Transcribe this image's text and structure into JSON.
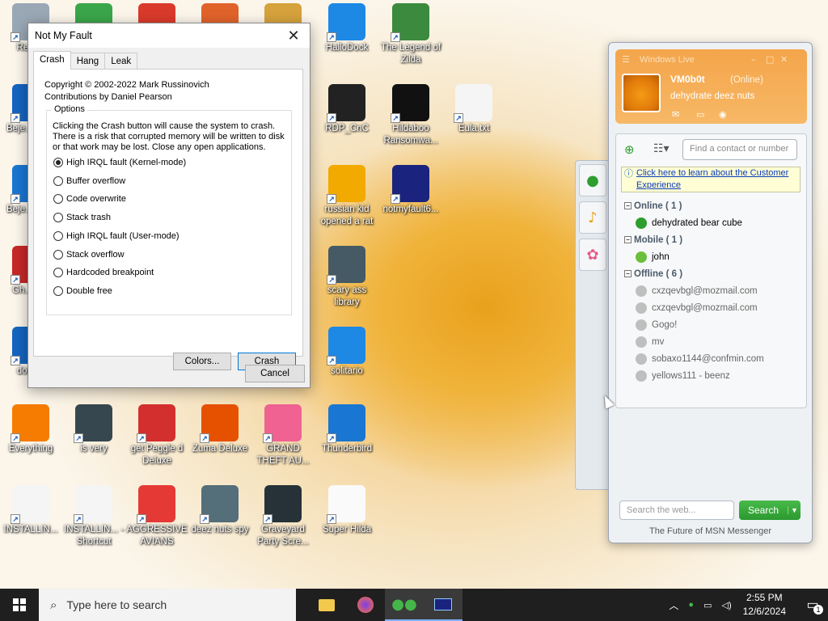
{
  "desktop": {
    "icons": [
      {
        "label": "Recy...",
        "color": "#9aa7b5"
      },
      {
        "label": "",
        "color": "#3aa64a"
      },
      {
        "label": "",
        "color": "#d93a2b"
      },
      {
        "label": "",
        "color": "#e0632a"
      },
      {
        "label": "",
        "color": "#d6a23c"
      },
      {
        "label": "HalloDock",
        "color": "#1e88e5"
      },
      {
        "label": "The Legend of Zilda",
        "color": "#3b8a3e"
      },
      {
        "label": "Beje... De...",
        "color": "#1565c0"
      },
      {
        "label": "RDP_CnC",
        "color": "#222222"
      },
      {
        "label": "Hildaboo Ransomwa...",
        "color": "#111111"
      },
      {
        "label": "Eula.txt",
        "color": "#f5f5f5"
      },
      {
        "label": "Beje... De...",
        "color": "#1976d2"
      },
      {
        "label": "russian kid opened a rat",
        "color": "#f2a900"
      },
      {
        "label": "notmyfault6...",
        "color": "#1a237e"
      },
      {
        "label": "Gh... D...",
        "color": "#c62828"
      },
      {
        "label": "scary ass library",
        "color": "#455a64"
      },
      {
        "label": "does...",
        "color": "#1565c0"
      },
      {
        "label": "solitario",
        "color": "#1e88e5"
      },
      {
        "label": "Everything",
        "color": "#f57c00"
      },
      {
        "label": "is very",
        "color": "#37474f"
      },
      {
        "label": "get Peggle d Deluxe",
        "color": "#d32f2f"
      },
      {
        "label": "Zuma Deluxe",
        "color": "#e65100"
      },
      {
        "label": "GRAND THEFT AU...",
        "color": "#f06292"
      },
      {
        "label": "Thunderbird",
        "color": "#1976d2"
      },
      {
        "label": "INSTALLIN...",
        "color": "#f5f5f5"
      },
      {
        "label": "INSTALLIN... - Shortcut",
        "color": "#f5f5f5"
      },
      {
        "label": "AGGRESSIVE AVIANS",
        "color": "#e53935"
      },
      {
        "label": "deez nuts spy",
        "color": "#546e7a"
      },
      {
        "label": "Graveyard Party Scre...",
        "color": "#263238"
      },
      {
        "label": "Super Hilda",
        "color": "#fafafa"
      }
    ]
  },
  "notmyfault": {
    "title": "Not My Fault",
    "tabs": [
      "Crash",
      "Hang",
      "Leak"
    ],
    "copyright": "Copyright © 2002-2022 Mark Russinovich",
    "contributions": "Contributions by Daniel Pearson",
    "options_legend": "Options",
    "warning": "Clicking the Crash button will cause the system to crash. There is a risk that corrupted memory will be written to disk or that work may be lost. Close any open applications.",
    "options": [
      "High IRQL fault (Kernel-mode)",
      "Buffer overflow",
      "Code overwrite",
      "Stack trash",
      "High IRQL fault (User-mode)",
      "Stack overflow",
      "Hardcoded breakpoint",
      "Double free"
    ],
    "selected_index": 0,
    "colors_button": "Colors...",
    "crash_button": "Crash",
    "cancel_button": "Cancel"
  },
  "messenger": {
    "window_title": "Windows Live",
    "username": "VM0b0t",
    "status": "(Online)",
    "personal_message": "dehydrate deez nuts",
    "find_placeholder": "Find a contact or number",
    "info_link": "Click here to learn about the Customer Experience",
    "groups": [
      {
        "name": "Online ( 1 )",
        "contacts": [
          {
            "name": "dehydrated bear cube",
            "status": "online"
          }
        ]
      },
      {
        "name": "Mobile ( 1 )",
        "contacts": [
          {
            "name": "john",
            "status": "mobile"
          }
        ]
      },
      {
        "name": "Offline ( 6 )",
        "contacts": [
          {
            "name": "cxzqevbgl@mozmail.com",
            "status": "offline"
          },
          {
            "name": "cxzqevbgl@mozmail.com",
            "status": "offline"
          },
          {
            "name": "Gogo!",
            "status": "offline"
          },
          {
            "name": "mv",
            "status": "offline"
          },
          {
            "name": "sobaxo1144@confmin.com",
            "status": "offline"
          },
          {
            "name": "yellows111 - beenz",
            "status": "offline"
          }
        ]
      }
    ],
    "search_placeholder": "Search the web...",
    "search_button": "Search",
    "footer": "The Future of MSN Messenger",
    "colors": {
      "online": "#2e9e2e",
      "mobile": "#6cbf3c",
      "offline": "#bfbfbf"
    }
  },
  "taskbar": {
    "search_placeholder": "Type here to search",
    "time": "2:55 PM",
    "date": "12/6/2024",
    "notification_count": "1"
  }
}
